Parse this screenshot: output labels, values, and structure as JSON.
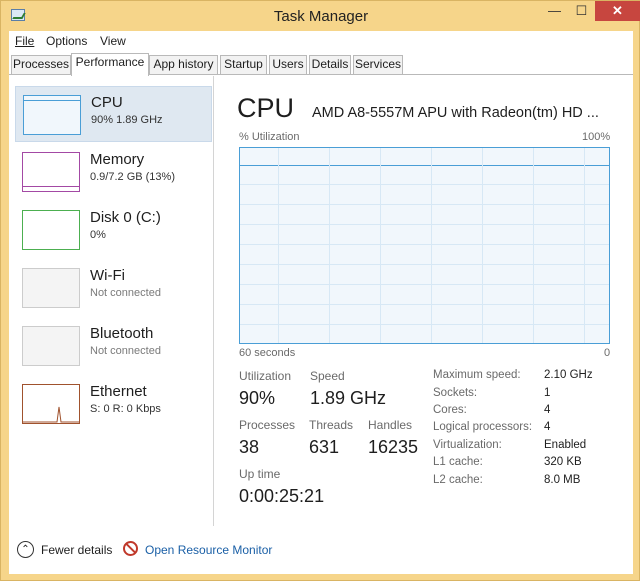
{
  "window": {
    "title": "Task Manager",
    "min": "—",
    "max": "☐",
    "close": "✕"
  },
  "menu": {
    "file": "File",
    "options": "Options",
    "view": "View"
  },
  "tabs": [
    "Processes",
    "Performance",
    "App history",
    "Startup",
    "Users",
    "Details",
    "Services"
  ],
  "colors": {
    "cpu": "#4a9ed6",
    "memory": "#a349a4",
    "disk": "#4caf50",
    "ethernet": "#a0522d"
  },
  "resources": [
    {
      "name": "CPU",
      "sub": "90% 1.89 GHz"
    },
    {
      "name": "Memory",
      "sub": "0.9/7.2 GB (13%)"
    },
    {
      "name": "Disk 0 (C:)",
      "sub": "0%"
    },
    {
      "name": "Wi-Fi",
      "sub": "Not connected"
    },
    {
      "name": "Bluetooth",
      "sub": "Not connected"
    },
    {
      "name": "Ethernet",
      "sub": "S: 0 R: 0 Kbps"
    }
  ],
  "detail": {
    "title": "CPU",
    "model": "AMD A8-5557M APU with Radeon(tm) HD ...",
    "util_label": "% Utilization",
    "max_label": "100%",
    "time_label": "60 seconds",
    "zero_label": "0"
  },
  "stats": {
    "utilization_label": "Utilization",
    "utilization": "90%",
    "speed_label": "Speed",
    "speed": "1.89 GHz",
    "processes_label": "Processes",
    "processes": "38",
    "threads_label": "Threads",
    "threads": "631",
    "handles_label": "Handles",
    "handles": "16235",
    "uptime_label": "Up time",
    "uptime": "0:00:25:21"
  },
  "specs": [
    {
      "key": "Maximum speed:",
      "val": "2.10 GHz"
    },
    {
      "key": "Sockets:",
      "val": "1"
    },
    {
      "key": "Cores:",
      "val": "4"
    },
    {
      "key": "Logical processors:",
      "val": "4"
    },
    {
      "key": "Virtualization:",
      "val": "Enabled"
    },
    {
      "key": "L1 cache:",
      "val": "320 KB"
    },
    {
      "key": "L2 cache:",
      "val": "8.0 MB"
    }
  ],
  "footer": {
    "fewer": "Fewer details",
    "orm": "Open Resource Monitor"
  }
}
